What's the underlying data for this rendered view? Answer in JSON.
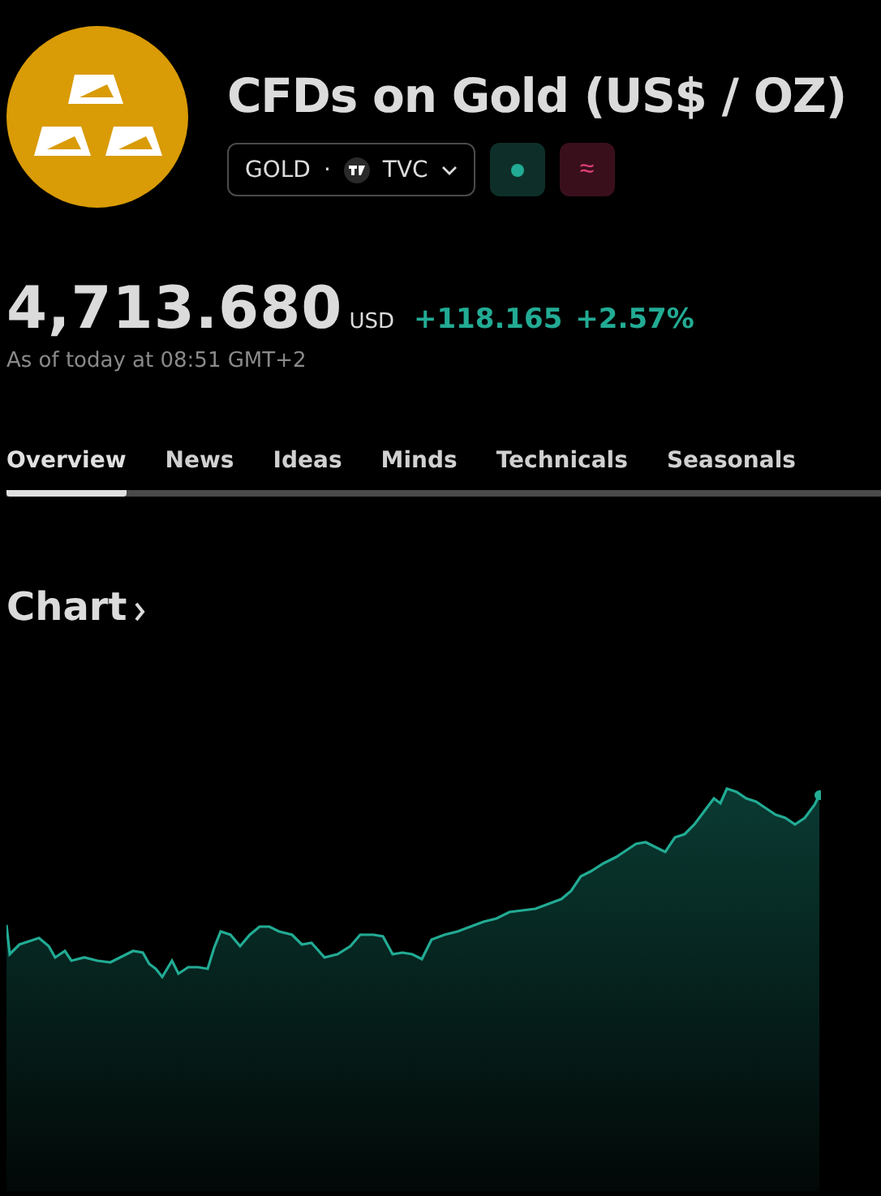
{
  "header": {
    "title": "CFDs on Gold (US$ / OZ)",
    "symbol": "GOLD",
    "separator": "·",
    "exchange": "TVC",
    "market_open": true,
    "badge_symbol": "≈"
  },
  "quote": {
    "price": "4,713.680",
    "currency": "USD",
    "change": "+118.165",
    "change_percent": "+2.57%",
    "as_of": "As of today at 08:51 GMT+2"
  },
  "tabs": [
    {
      "label": "Overview",
      "selected": true
    },
    {
      "label": "News",
      "selected": false
    },
    {
      "label": "Ideas",
      "selected": false
    },
    {
      "label": "Minds",
      "selected": false
    },
    {
      "label": "Technicals",
      "selected": false
    },
    {
      "label": "Seasonals",
      "selected": false
    }
  ],
  "chart": {
    "title": "Chart"
  }
}
